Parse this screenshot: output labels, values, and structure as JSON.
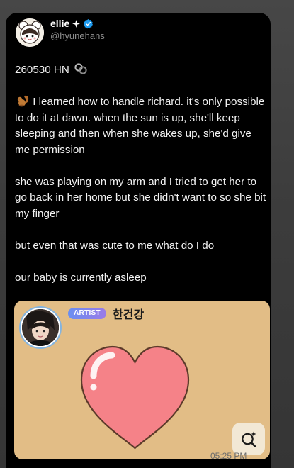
{
  "post": {
    "display_name": "ellie",
    "handle": "@hyunehans",
    "paragraphs": [
      "260530 HN",
      "I learned how to handle richard. it's only possible to do it at dawn. when the sun is up, she'll keep sleeping and then when she wakes up, she'd give me permission",
      "she was playing on my arm and I tried to get her to go back in her home but she didn't want to so she bit my finger",
      "but even that was cute to me what do I do",
      "our baby is currently asleep"
    ],
    "icons": {
      "name_sparkle": "sparkle-icon",
      "verified": "verified-badge-icon",
      "first_paragraph": "link-rings-icon",
      "second_paragraph": "squirrel-emoji-icon"
    }
  },
  "media": {
    "badge_label": "ARTIST",
    "artist_name": "한건강",
    "heart_color": "#f58288",
    "background_color": "#e2bd86",
    "action_icon": "visual-search-icon"
  },
  "timestamp": "05:25 PM",
  "colors": {
    "card_background": "#000000",
    "verified_blue": "#1d9bf0",
    "badge_gradient": [
      "#6a8ff0",
      "#9b7ae8"
    ]
  }
}
